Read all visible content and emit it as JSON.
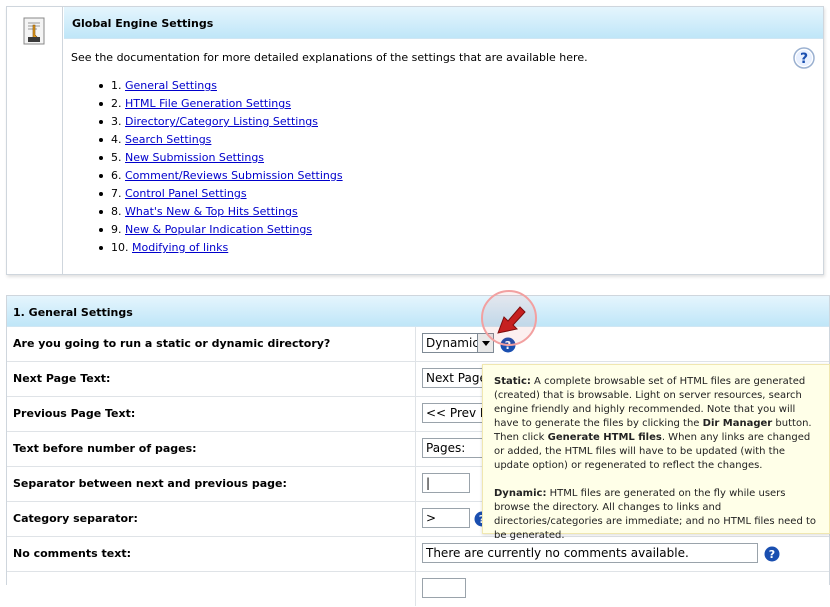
{
  "panel": {
    "title": "Global Engine Settings",
    "intro": "See the documentation for more detailed explanations of the settings that are available here.",
    "links": [
      {
        "num": "1.",
        "label": "General Settings"
      },
      {
        "num": "2.",
        "label": "HTML File Generation Settings"
      },
      {
        "num": "3.",
        "label": "Directory/Category Listing Settings"
      },
      {
        "num": "4.",
        "label": "Search Settings"
      },
      {
        "num": "5.",
        "label": "New Submission Settings"
      },
      {
        "num": "6.",
        "label": "Comment/Reviews Submission Settings"
      },
      {
        "num": "7.",
        "label": "Control Panel Settings"
      },
      {
        "num": "8.",
        "label": "What's New & Top Hits Settings"
      },
      {
        "num": "9.",
        "label": "New & Popular Indication Settings"
      },
      {
        "num": "10.",
        "label": "Modifying of links"
      }
    ]
  },
  "settings": {
    "header": "1. General Settings",
    "rows": [
      {
        "label": "Are you going to run a static or dynamic directory?",
        "value": "Dynamic"
      },
      {
        "label": "Next Page Text:",
        "value": "Next Page"
      },
      {
        "label": "Previous Page Text:",
        "value": "<< Prev P"
      },
      {
        "label": "Text before number of pages:",
        "value": "Pages:"
      },
      {
        "label": "Separator between next and previous page:",
        "value": "|"
      },
      {
        "label": "Category separator:",
        "value": ">"
      },
      {
        "label": "No comments text:",
        "value": "There are currently no comments available."
      }
    ]
  },
  "tooltip": {
    "static_term": "Static:",
    "static_text_1": " A complete browsable set of HTML files are generated (created) that is browsable. Light on server resources, search engine friendly and highly recommended. Note that you will have to generate the files by clicking the ",
    "dir_manager": "Dir Manager",
    "static_text_2": " button. Then click ",
    "generate_html": "Generate HTML files",
    "static_text_3": ". When any links are changed or added, the HTML files will have to be updated (with the update option) or regenerated to reflect the changes.",
    "dynamic_term": "Dynamic:",
    "dynamic_text": " HTML files are generated on the fly while users browse the directory. All changes to links and directories/categories are immediate; and no HTML files need to be generated."
  },
  "icons": {
    "doc": "document-icon",
    "help": "help-question-icon",
    "arrow": "red-arrow-pointer-icon"
  },
  "colors": {
    "header_gradient_top": "#e5f5fd",
    "header_gradient_bottom": "#bfe6f8",
    "link": "#0000cc",
    "tooltip_bg": "#ffffe8",
    "help_blue": "#1a4fb0",
    "arrow_red": "#c62020"
  }
}
